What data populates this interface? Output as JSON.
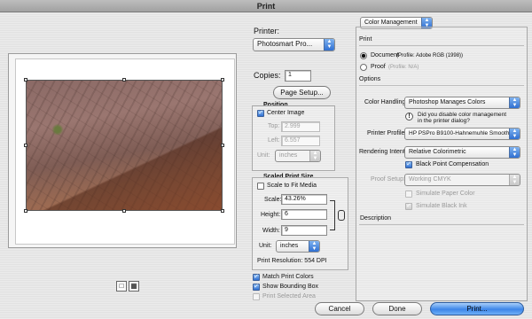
{
  "window": {
    "title": "Print"
  },
  "printer": {
    "label": "Printer:",
    "value": "Photosmart Pro..."
  },
  "copies": {
    "label": "Copies:",
    "value": "1"
  },
  "page_setup_button": "Page Setup...",
  "position": {
    "title": "Position",
    "center_image_label": "Center Image",
    "center_image_checked": true,
    "top_label": "Top:",
    "top_value": "2.999",
    "left_label": "Left:",
    "left_value": "6.557",
    "unit_label": "Unit:",
    "unit_value": "inches"
  },
  "scaled_print_size": {
    "title": "Scaled Print Size",
    "scale_to_fit_label": "Scale to Fit Media",
    "scale_to_fit_checked": false,
    "scale_label": "Scale:",
    "scale_value": "43.26%",
    "height_label": "Height:",
    "height_value": "6",
    "width_label": "Width:",
    "width_value": "9",
    "unit_label": "Unit:",
    "unit_value": "inches",
    "resolution": "Print Resolution: 554 DPI"
  },
  "options": {
    "match_print_colors": "Match Print Colors",
    "match_print_colors_checked": true,
    "show_bounding_box": "Show Bounding Box",
    "show_bounding_box_checked": true,
    "print_selected_area": "Print Selected Area",
    "print_selected_area_checked": false
  },
  "color_management": {
    "menu_value": "Color Management",
    "print_heading": "Print",
    "document_label": "Document",
    "document_profile": "(Profile: Adobe RGB (1998))",
    "proof_label": "Proof",
    "proof_profile": "(Profile: N/A)",
    "options_heading": "Options",
    "color_handling_label": "Color Handling:",
    "color_handling_value": "Photoshop Manages Colors",
    "warning_text_line1": "Did you disable color management",
    "warning_text_line2": "in the printer dialog?",
    "printer_profile_label": "Printer Profile:",
    "printer_profile_value": "HP PSPro B9100-Hahnemuhle Smooth ...",
    "rendering_intent_label": "Rendering Intent:",
    "rendering_intent_value": "Relative Colorimetric",
    "black_point_label": "Black Point Compensation",
    "black_point_checked": true,
    "proof_setup_label": "Proof Setup:",
    "proof_setup_value": "Working CMYK",
    "simulate_paper_label": "Simulate Paper Color",
    "simulate_black_label": "Simulate Black Ink",
    "description_heading": "Description"
  },
  "buttons": {
    "cancel": "Cancel",
    "done": "Done",
    "print": "Print..."
  },
  "colors": {
    "accent": "#3d86e8",
    "window_bg": "#e4e4e4"
  }
}
